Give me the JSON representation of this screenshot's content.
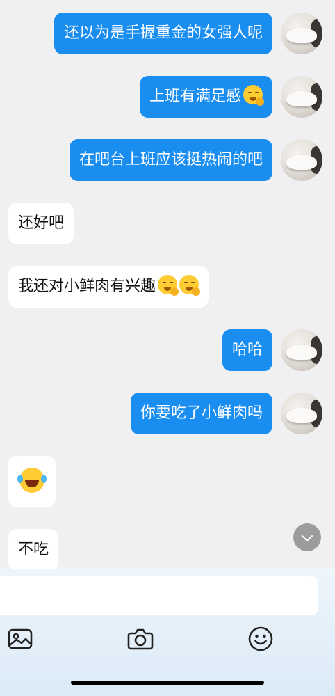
{
  "messages": [
    {
      "side": "me",
      "text": "还以为是手握重金的女强人呢",
      "emoji": ""
    },
    {
      "side": "me",
      "text": "上班有满足感",
      "emoji": "thinking"
    },
    {
      "side": "me",
      "text": "在吧台上班应该挺热闹的吧",
      "emoji": ""
    },
    {
      "side": "other",
      "text": "还好吧",
      "emoji": ""
    },
    {
      "side": "other",
      "text": "我还对小鲜肉有兴趣",
      "emoji": "thinking x2"
    },
    {
      "side": "me",
      "text": "哈哈",
      "emoji": ""
    },
    {
      "side": "me",
      "text": "你要吃了小鲜肉吗",
      "emoji": ""
    },
    {
      "side": "other",
      "text": "",
      "emoji": "laughing-crying"
    },
    {
      "side": "other",
      "text": "不吃",
      "emoji": ""
    }
  ],
  "composer": {
    "placeholder": "",
    "tools": [
      "image-icon",
      "camera-icon",
      "emoji-icon"
    ]
  },
  "colors": {
    "sent_bubble": "#1a8df0",
    "received_bubble": "#ffffff",
    "background": "#f0f0f2"
  }
}
